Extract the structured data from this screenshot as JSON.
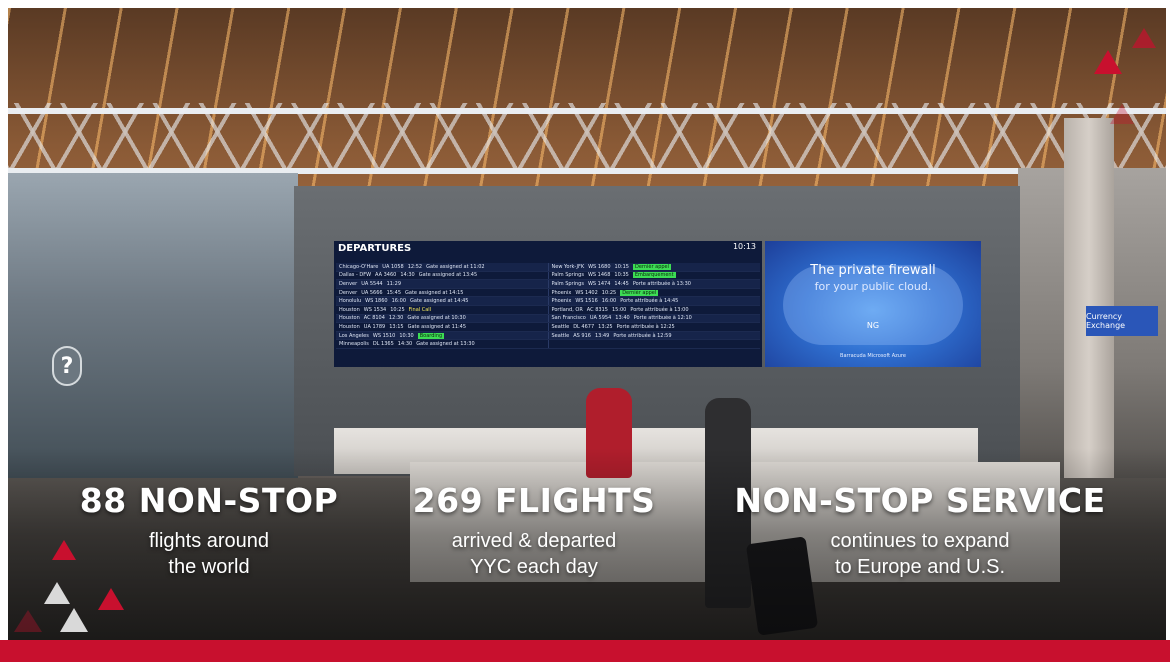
{
  "stats": [
    {
      "headline": "88 NON-STOP",
      "line1": "flights around",
      "line2": "the world"
    },
    {
      "headline": "269 FLIGHTS",
      "line1": "arrived & departed",
      "line2": "YYC each day"
    },
    {
      "headline": "NON-STOP SERVICE",
      "line1": "continues to expand",
      "line2": "to Europe and U.S."
    }
  ],
  "scene": {
    "board_title": "DEPARTURES",
    "board_time": "10:13",
    "ad_title": "The private firewall",
    "ad_subtitle": "for your public cloud.",
    "ad_mark": "NG",
    "ad_logos": "Barracuda    Microsoft Azure",
    "exchange_sign": "Currency Exchange",
    "info_symbol": "?",
    "board_rows": [
      [
        "Chicago-O'Hare",
        "UA 1058",
        "12:52",
        "Gate assigned at 11:02",
        "New York-JFK",
        "WS 1680",
        "10:15",
        "Dernièr appel"
      ],
      [
        "Dallas - DFW",
        "AA 3460",
        "14:30",
        "Gate assigned at 13:45",
        "Palm Springs",
        "WS 1468",
        "10:35",
        "Embarquement"
      ],
      [
        "Denver",
        "UA 5544",
        "11:29",
        "",
        "Palm Springs",
        "WS 1474",
        "14:45",
        "Porte attribuée à 13:30"
      ],
      [
        "Denver",
        "UA 5666",
        "15:45",
        "Gate assigned at 14:15",
        "Phoenix",
        "WS 1402",
        "10:25",
        "Dernièr appel"
      ],
      [
        "Honolulu",
        "WS 1860",
        "16:00",
        "Gate assigned at 14:45",
        "Phoenix",
        "WS 1516",
        "16:00",
        "Porte attribuée à 14:45"
      ],
      [
        "Houston",
        "WS 1534",
        "10:25",
        "Final Call",
        "Portland, OR",
        "AC 8315",
        "15:00",
        "Porte attribuée à 13:00"
      ],
      [
        "Houston",
        "AC 8104",
        "12:30",
        "Gate assigned at 10:30",
        "San Francisco",
        "UA 5954",
        "13:40",
        "Porte attribuée à 12:10"
      ],
      [
        "Houston",
        "UA 1789",
        "13:15",
        "Gate assigned at 11:45",
        "Seattle",
        "DL 4677",
        "13:25",
        "Porte attribuée à 12:25"
      ],
      [
        "Los Angeles",
        "WS 1510",
        "10:30",
        "Boarding",
        "Seattle",
        "AS 916",
        "13:49",
        "Porte attribuée à 12:59"
      ],
      [
        "Minneapolis",
        "DL 1365",
        "14:30",
        "Gate assigned at 13:30",
        "",
        "",
        "",
        ""
      ]
    ]
  },
  "colors": {
    "accent_red": "#c8102e",
    "light_gray": "#d9d9d9"
  }
}
